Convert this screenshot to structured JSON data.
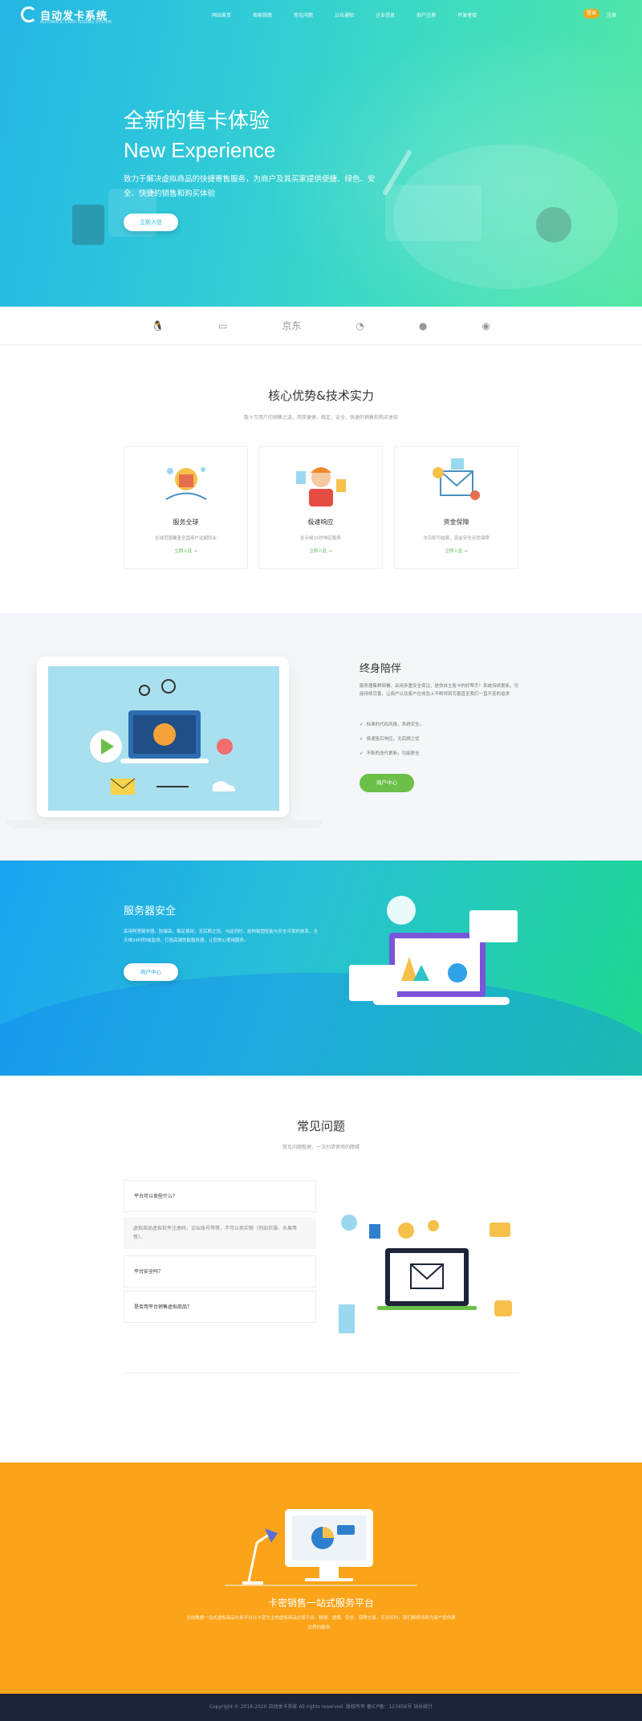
{
  "header": {
    "logo_name": "自动发卡系统",
    "logo_sub": "AUTOMATIC CARD ISSUING SYSTEM",
    "nav": [
      "网站首页",
      "商家指南",
      "常见问题",
      "公告通知",
      "企业信息",
      "商户注册",
      "开发者接"
    ],
    "login": "登录",
    "register": "注册"
  },
  "hero": {
    "title": "全新的售卡体验",
    "title_en": "New Experience",
    "desc": "致力于解决虚拟商品的快捷寄售服务，为商户及其买家提供便捷、绿色、安全、快捷的销售和购买体验",
    "button": "立即入驻"
  },
  "partners": [
    "QQ",
    "银联",
    "京东",
    "财付通",
    "微信",
    "支付宝"
  ],
  "advantages": {
    "title": "核心优势&技术实力",
    "subtitle": "数十万用户的销售之选，简单便捷，稳定，安全，快速的销售和购买体验",
    "cards": [
      {
        "title": "服务全球",
        "desc": "全球范围覆盖全国用户远超同业",
        "link": "立即入驻 →"
      },
      {
        "title": "极速响应",
        "desc": "全天候15秒响应服务",
        "link": "立即入驻 →"
      },
      {
        "title": "资金保障",
        "desc": "次日即可结算，资金安全无忧保障",
        "link": "立即入驻 →"
      }
    ]
  },
  "lifetime": {
    "title": "终身陪伴",
    "desc": "服务器集群部署，采用多重安全保证，是你自主售卡的好帮手！系统持续更新，功能持续完善，让商户以及客户在体验上不断得到完善直至我们一直不变的追求",
    "checks": [
      "标准的代码风格，系统安全。",
      "极速售后响应，无后顾之忧",
      "不断的迭代更新，功能更全"
    ],
    "button": "商户中心"
  },
  "server": {
    "title": "服务器安全",
    "desc": "采用阿里服务器，防御高，稳定易用，无后顾之忧。与此同时，结构稳固性能与安全可靠的体系，全天候24时秒级监测，打造高端性能服务器，让您放心使用服务。",
    "button": "商户中心"
  },
  "faq": {
    "title": "常见问题",
    "subtitle": "常见问题整理，一次扫清使用的障碍",
    "items": [
      {
        "q": "平台可以卖些什么？"
      },
      {
        "q": "平台安全吗？"
      },
      {
        "q": "是否用平台销售虚拟商品？"
      }
    ],
    "answer": "虚拟商品虚拟软件注册码，论坛账号等等，不可以卖实物（例如衣服、水果等等）。"
  },
  "platform": {
    "title": "卡密销售一站式服务平台",
    "desc": "当前数据一站式虚拟商品交易平台以卡密为主的虚拟商品交易平台，精细、便捷、安全，保障交易，无论何时，我们都将持续为商户提供更优质的服务。"
  },
  "footer": {
    "text": "Copyright © 2018-2020 自动发卡系统 All rights reserved. 版权所有 备ICP备：123456号 站长统计"
  }
}
